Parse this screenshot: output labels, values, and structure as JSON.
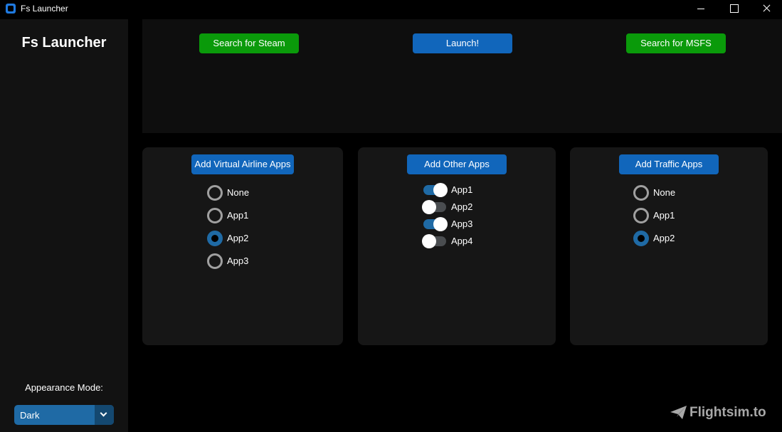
{
  "window": {
    "title": "Fs Launcher"
  },
  "sidebar": {
    "brand": "Fs Launcher",
    "appearance_label": "Appearance Mode:",
    "appearance_value": "Dark"
  },
  "top": {
    "steam_button": "Search for Steam",
    "launch_button": "Launch!",
    "msfs_button": "Search for MSFS"
  },
  "virtual_airline": {
    "button": "Add Virtual Airline Apps",
    "options": [
      "None",
      "App1",
      "App2",
      "App3"
    ],
    "selected": "App2"
  },
  "other_apps": {
    "button": "Add Other Apps",
    "switches": [
      {
        "label": "App1",
        "on": true
      },
      {
        "label": "App2",
        "on": false
      },
      {
        "label": "App3",
        "on": true
      },
      {
        "label": "App4",
        "on": false
      }
    ]
  },
  "traffic": {
    "button": "Add Traffic Apps",
    "options": [
      "None",
      "App1",
      "App2"
    ],
    "selected": "App2"
  },
  "watermark": {
    "text": "Flightsim.to"
  },
  "colors": {
    "accent": "#1f6aa5",
    "green": "#0a9a0a",
    "button_blue": "#1166bb"
  }
}
